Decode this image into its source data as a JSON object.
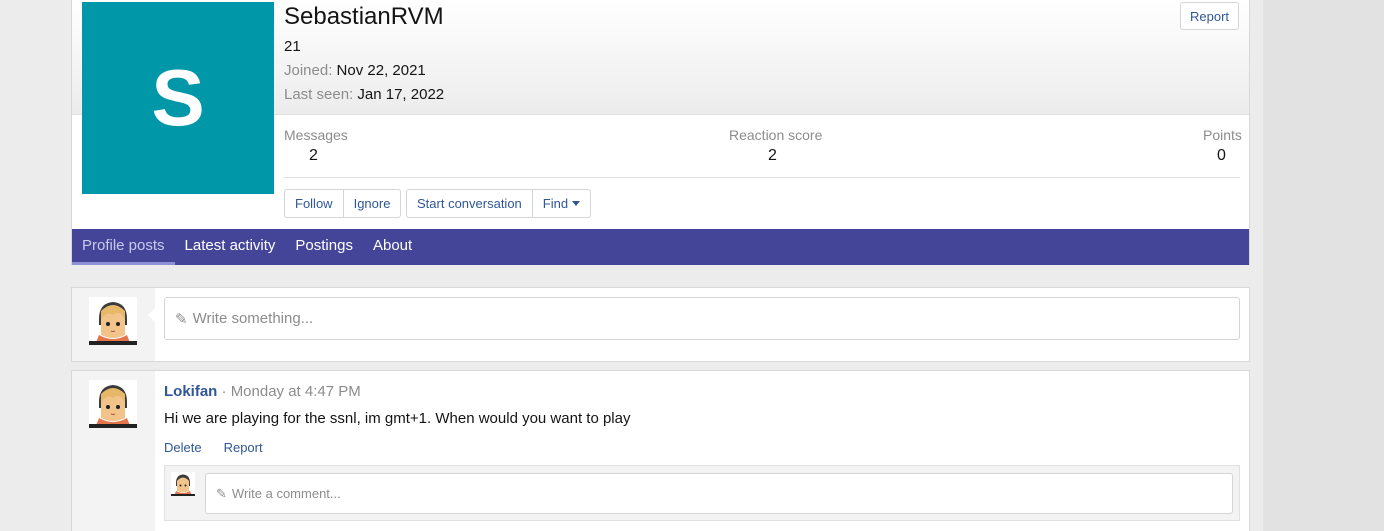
{
  "profile": {
    "avatar_letter": "S",
    "username": "SebastianRVM",
    "age": "21",
    "joined_label": "Joined:",
    "joined_value": "Nov 22, 2021",
    "last_seen_label": "Last seen:",
    "last_seen_value": "Jan 17, 2022",
    "report_label": "Report",
    "stats": {
      "messages_label": "Messages",
      "messages_value": "2",
      "reaction_label": "Reaction score",
      "reaction_value": "2",
      "points_label": "Points",
      "points_value": "0"
    },
    "buttons": {
      "follow": "Follow",
      "ignore": "Ignore",
      "start_conversation": "Start conversation",
      "find": "Find"
    }
  },
  "tabs": [
    {
      "label": "Profile posts",
      "active": true
    },
    {
      "label": "Latest activity",
      "active": false
    },
    {
      "label": "Postings",
      "active": false
    },
    {
      "label": "About",
      "active": false
    }
  ],
  "composer": {
    "placeholder": "Write something..."
  },
  "post": {
    "author": "Lokifan",
    "separator": " · ",
    "time": "Monday at 4:47 PM",
    "body": "Hi we are playing for the ssnl, im gmt+1. When would you want to play",
    "delete_label": "Delete",
    "report_label": "Report",
    "comment_placeholder": "Write a comment..."
  },
  "colors": {
    "avatar_bg": "#0098a8",
    "tab_bar": "#444599",
    "link": "#2f5797"
  },
  "icons": {
    "pencil": "pencil-icon",
    "caret": "caret-down-icon"
  }
}
